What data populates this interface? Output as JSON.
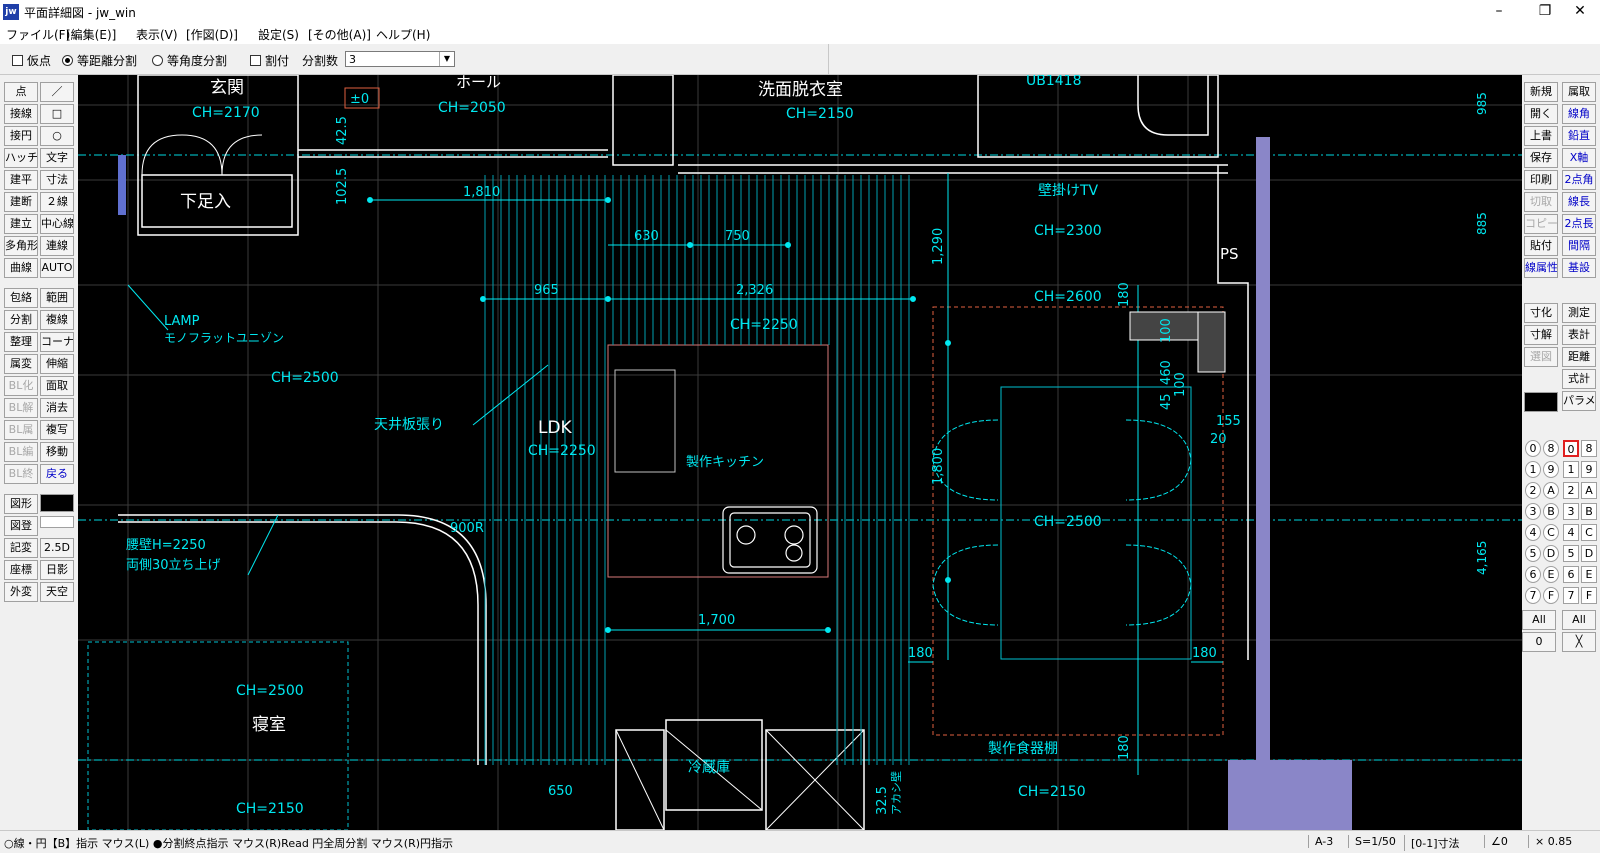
{
  "window": {
    "title": "平面詳細図 - jw_win",
    "app_icon": "jw",
    "controls": [
      "–",
      "❐",
      "✕"
    ]
  },
  "menu": [
    "ファイル(F)",
    "[編集(E)]",
    "表示(V)",
    "[作図(D)]",
    "設定(S)",
    "[その他(A)]",
    "ヘルプ(H)"
  ],
  "options": {
    "kariten": "仮点",
    "tokyori": "等距離分割",
    "tokakudo": "等角度分割",
    "waritsuke": "割付",
    "bunkatsu_label": "分割数",
    "bunkatsu_value": "3"
  },
  "left_tools": [
    [
      "点",
      "／"
    ],
    [
      "接線",
      "□"
    ],
    [
      "接円",
      "○"
    ],
    [
      "ハッチ",
      "文字"
    ],
    [
      "建平",
      "寸法"
    ],
    [
      "建断",
      "２線"
    ],
    [
      "建立",
      "中心線"
    ],
    [
      "多角形",
      "連線"
    ],
    [
      "曲線",
      "AUTO"
    ],
    [
      "包絡",
      "範囲"
    ],
    [
      "分割",
      "複線"
    ],
    [
      "整理",
      "コーナー"
    ],
    [
      "属変",
      "伸縮"
    ],
    [
      "BL化",
      "面取"
    ],
    [
      "BL解",
      "消去"
    ],
    [
      "BL属",
      "複写"
    ],
    [
      "BL編",
      "移動"
    ],
    [
      "BL終",
      "戻る"
    ],
    [
      "図形",
      ""
    ],
    [
      "図登",
      ""
    ],
    [
      "記変",
      "2.5D"
    ],
    [
      "座標",
      "日影"
    ],
    [
      "外変",
      "天空"
    ]
  ],
  "right_tools_a": [
    [
      "新規",
      "開く",
      "上書",
      "保存",
      "印刷",
      "切取",
      "コピー",
      "貼付",
      "線属性"
    ],
    [
      "寸化",
      "寸解",
      "選図"
    ]
  ],
  "right_tools_b": [
    [
      "属取",
      "線角",
      "鉛直",
      "X軸",
      "2点角",
      "線長",
      "2点長",
      "間隔",
      "基設"
    ],
    [
      "測定",
      "表計",
      "距離",
      "式計",
      "パラメ"
    ]
  ],
  "layer_groups": [
    "0",
    "1",
    "2",
    "3",
    "4",
    "5",
    "6",
    "7",
    "8",
    "9",
    "A",
    "B",
    "C",
    "D",
    "E",
    "F"
  ],
  "layer_all": "All",
  "layer_zero": "0",
  "drawing": {
    "rooms": [
      "玄関",
      "ホール",
      "洗面脱衣室",
      "LDK",
      "寝室",
      "冷蔵庫",
      "下足入",
      "製作キッチン",
      "製作食器棚",
      "壁掛けTV",
      "PS",
      "UB1418",
      "天井板張り"
    ],
    "ch_labels": [
      "CH=2170",
      "CH=2050",
      "CH=2150",
      "CH=2300",
      "CH=2600",
      "CH=2250",
      "CH=2500",
      "CH=2250",
      "CH=2500",
      "CH=2500",
      "CH=2150",
      "CH=2150"
    ],
    "dims": [
      "1,810",
      "630",
      "750",
      "965",
      "2,326",
      "1,290",
      "1,800",
      "1,700",
      "180",
      "180",
      "180",
      "100",
      "460",
      "45",
      "100",
      "155",
      "20",
      "42.5",
      "102.5",
      "650",
      "32.5",
      "900R",
      "985",
      "885",
      "4,165",
      "180"
    ],
    "annotations": [
      "LAMP",
      "モノフラットユニゾン",
      "腰壁H=2250",
      "両側30立ち上げ",
      "±0",
      "アカシ壁"
    ]
  },
  "status": {
    "left": "○線・円【B】指示 マウス(L) ●分割終点指示 マウス(R)Read 円全周分割 マウス(R)円指示",
    "paper": "A-3",
    "scale": "S=1/50",
    "mode": "[0-1]寸法",
    "angle": "∠0",
    "zoom": "× 0.85"
  }
}
